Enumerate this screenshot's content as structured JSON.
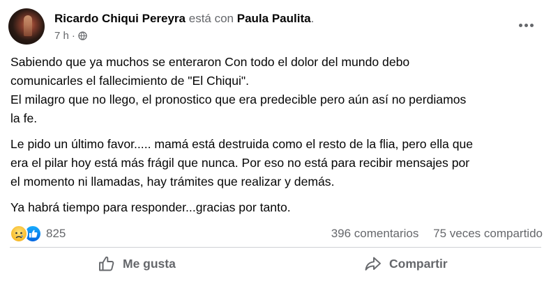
{
  "post": {
    "author": "Ricardo Chiqui Pereyra",
    "with_text": "está con",
    "tagged": "Paula Paulita",
    "tagged_suffix": ".",
    "time": "7 h",
    "time_sep": "·",
    "body": [
      "Sabiendo que ya muchos se enteraron Con todo el dolor del mundo debo",
      "comunicarles el fallecimiento de \"El Chiqui\".",
      "El milagro que no llego, el pronostico que era predecible pero aún así no perdiamos",
      "la fe.",
      "Le pido un último favor..... mamá está destruida como el resto de la flia, pero ella que",
      "era el pilar hoy está más frágil que nunca. Por eso  no está para recibir mensajes por",
      "el momento ni llamadas, hay trámites que realizar y demás.",
      "Ya habrá tiempo para responder...gracias por tanto."
    ]
  },
  "stats": {
    "reaction_count": "825",
    "comments": "396 comentarios",
    "shares": "75 veces compartido"
  },
  "actions": {
    "like_label": "Me gusta",
    "share_label": "Compartir"
  },
  "icons": {
    "privacy": "globe-icon",
    "more": "more-options-icon",
    "reaction_1": "sad-reaction-icon",
    "reaction_2": "like-reaction-icon",
    "like_action": "thumbs-up-icon",
    "share_action": "share-arrow-icon"
  },
  "colors": {
    "text": "#050505",
    "secondary": "#65676b",
    "like_blue": "#0165e1",
    "sad_yellow": "#f7b928",
    "divider": "#ced0d4"
  }
}
